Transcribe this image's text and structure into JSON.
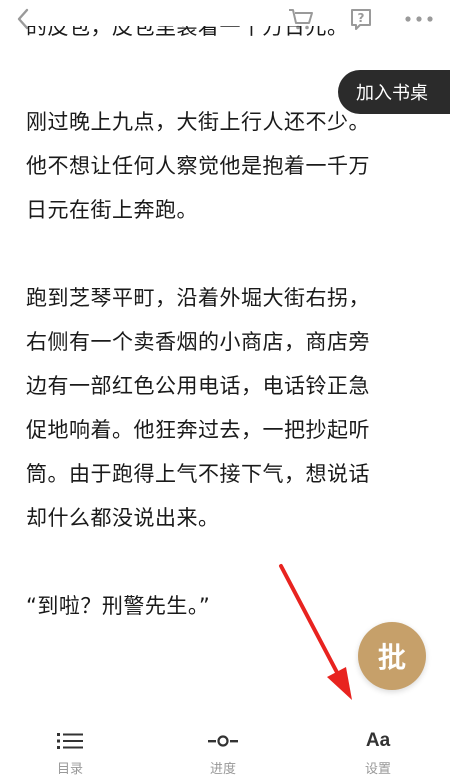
{
  "header": {
    "back_icon": "chevron-left-icon",
    "cart_icon": "cart-icon",
    "help_icon": "question-icon",
    "more_icon": "more-icon"
  },
  "add_to_desk": "加入书桌",
  "content": {
    "partial_line": "的皮包，皮包里装着一千万日元。",
    "lines": [
      "刚过晚上九点，大街上行人还不少。",
      "他不想让任何人察觉他是抱着一千万",
      "日元在街上奔跑。",
      "",
      "跑到芝琴平町，沿着外堀大街右拐，",
      "右侧有一个卖香烟的小商店，商店旁",
      "边有一部红色公用电话，电话铃正急",
      "促地响着。他狂奔过去，一把抄起听",
      "筒。由于跑得上气不接下气，想说话",
      "却什么都没说出来。",
      "",
      "“到啦？刑警先生。”"
    ]
  },
  "floating_button": "批",
  "bottom_nav": {
    "toc": {
      "label": "目录",
      "icon": "list-icon"
    },
    "progress": {
      "label": "进度",
      "icon": "progress-icon"
    },
    "settings": {
      "label": "设置",
      "glyph": "Aa"
    }
  },
  "annotation_color": "#e8231f"
}
